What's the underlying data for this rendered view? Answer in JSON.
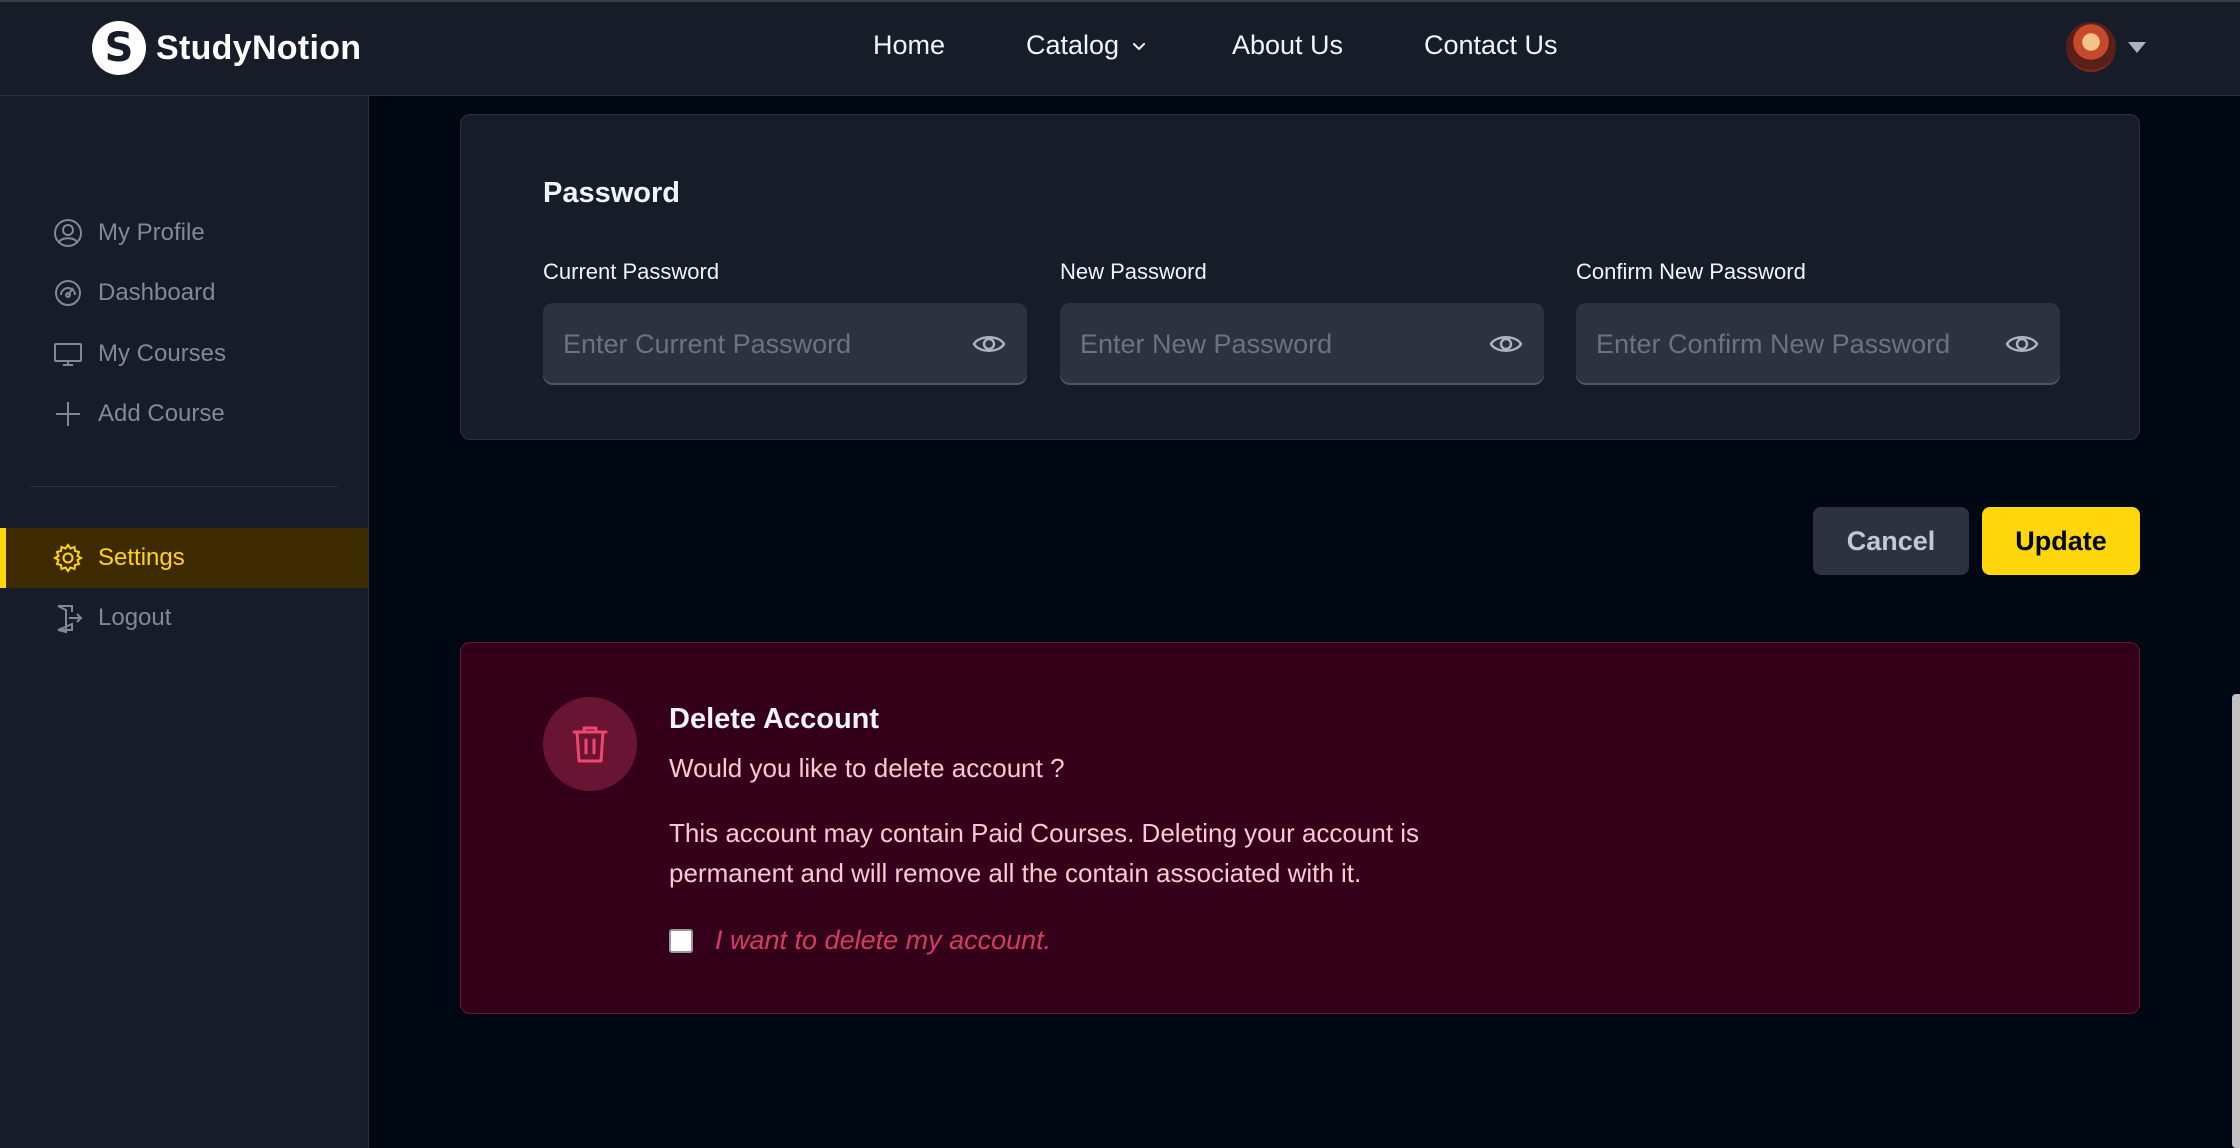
{
  "brand": {
    "logo_letter": "S",
    "name": "StudyNotion"
  },
  "nav": {
    "items": [
      {
        "label": "Home"
      },
      {
        "label": "Catalog",
        "has_dropdown": true
      },
      {
        "label": "About Us"
      },
      {
        "label": "Contact Us"
      }
    ]
  },
  "sidebar": {
    "items": [
      {
        "label": "My Profile",
        "icon": "user-circle-icon"
      },
      {
        "label": "Dashboard",
        "icon": "gauge-icon"
      },
      {
        "label": "My Courses",
        "icon": "monitor-icon"
      },
      {
        "label": "Add Course",
        "icon": "plus-icon"
      }
    ],
    "bottom_items": [
      {
        "label": "Settings",
        "icon": "gear-icon",
        "active": true
      },
      {
        "label": "Logout",
        "icon": "logout-icon"
      }
    ]
  },
  "password": {
    "title": "Password",
    "fields": [
      {
        "label": "Current Password",
        "placeholder": "Enter Current Password",
        "value": ""
      },
      {
        "label": "New Password",
        "placeholder": "Enter New Password",
        "value": ""
      },
      {
        "label": "Confirm New Password",
        "placeholder": "Enter Confirm New Password",
        "value": ""
      }
    ]
  },
  "actions": {
    "cancel_label": "Cancel",
    "update_label": "Update"
  },
  "delete_account": {
    "title": "Delete Account",
    "question": "Would you like to delete account ?",
    "description": "This account may contain Paid Courses. Deleting your account is permanent and will remove all the contain associated with it.",
    "confirm_label": "I want to delete my account.",
    "confirm_checked": false
  },
  "colors": {
    "accent": "#ffd60a",
    "page_bg": "#000814",
    "panel_bg": "#161d29",
    "danger_bg": "#340019",
    "danger_text": "#d43d63"
  }
}
